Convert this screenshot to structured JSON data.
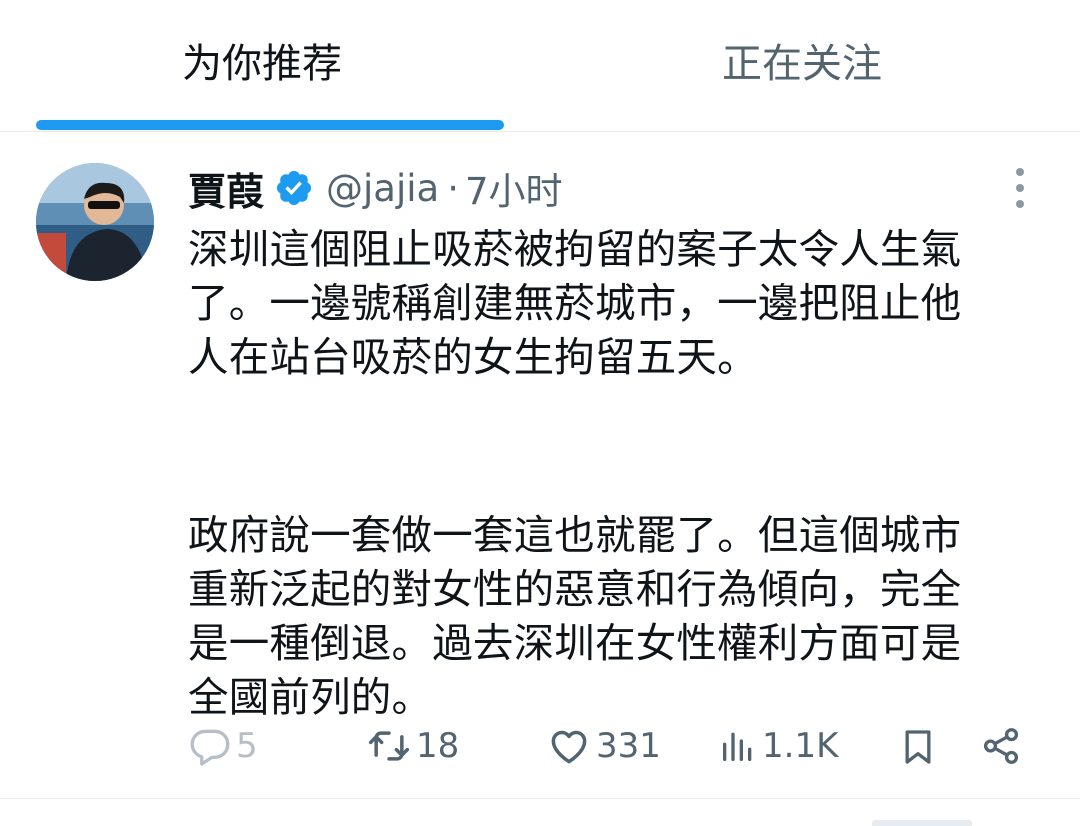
{
  "tabs": [
    {
      "label": "为你推荐",
      "active": true
    },
    {
      "label": "正在关注",
      "active": false
    }
  ],
  "accent_color": "#1d9bf0",
  "tweet": {
    "author_name": "賈葭",
    "verified": true,
    "handle": "@jajia",
    "separator": "·",
    "time": "7小时",
    "body_lines": [
      "深圳這個阻止吸菸被拘留的案子太令人生氣",
      "了。一邊號稱創建無菸城市，一邊把阻止他",
      "人在站台吸菸的女生拘留五天。",
      "政府說一套做一套這也就罷了。但這個城市",
      "重新泛起的對女性的惡意和行為傾向，完全",
      "是一種倒退。過去深圳在女性權利方面可是",
      "全國前列的。"
    ],
    "actions": {
      "replies": "5",
      "retweets": "18",
      "likes": "331",
      "views": "1.1K"
    },
    "icons": {
      "reply": "reply-icon",
      "retweet": "retweet-icon",
      "like": "heart-icon",
      "views": "views-icon",
      "bookmark": "bookmark-icon",
      "share": "share-icon",
      "more": "more-vertical-icon",
      "verified": "verified-badge-icon"
    }
  }
}
